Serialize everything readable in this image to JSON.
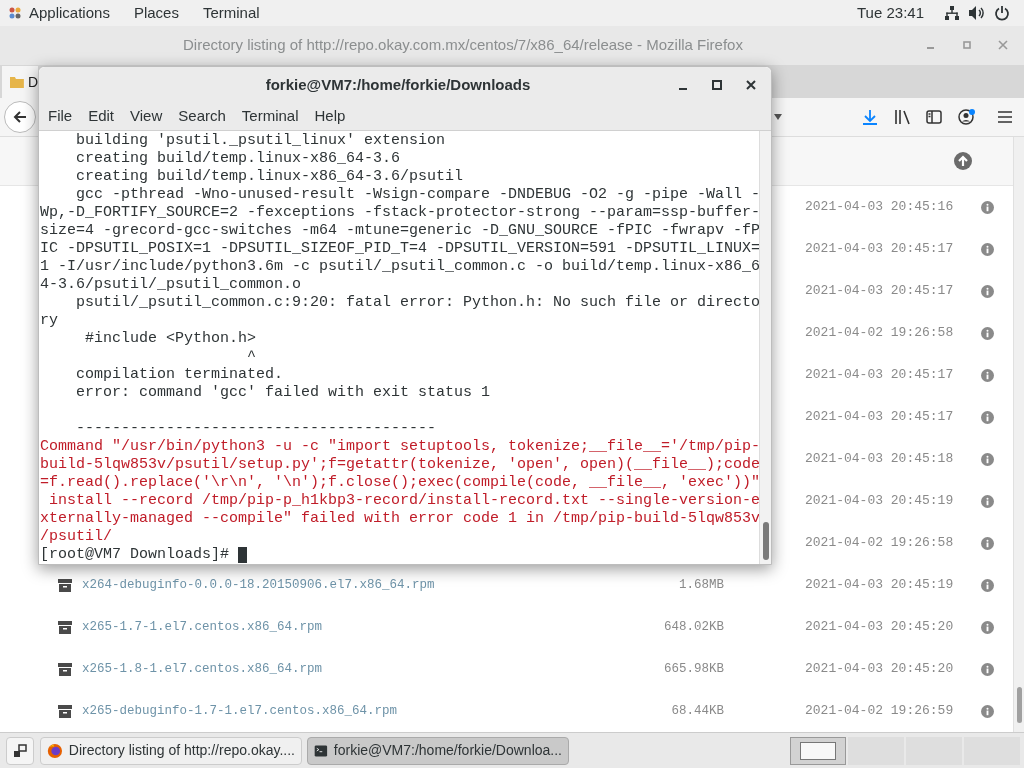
{
  "top_bar": {
    "menus": [
      "Applications",
      "Places",
      "Terminal"
    ],
    "clock": "Tue 23:41"
  },
  "browser": {
    "title": "Directory listing of http://repo.okay.com.mx/centos/7/x86_64/release - Mozilla Firefox",
    "tab": {
      "label": "D"
    },
    "listing": [
      {
        "date": "2021-04-03 20:45:16"
      },
      {
        "date": "2021-04-03 20:45:17"
      },
      {
        "date": "2021-04-03 20:45:17"
      },
      {
        "date": "2021-04-02 19:26:58"
      },
      {
        "date": "2021-04-03 20:45:17"
      },
      {
        "date": "2021-04-03 20:45:17"
      },
      {
        "date": "2021-04-03 20:45:18"
      },
      {
        "date": "2021-04-03 20:45:19"
      },
      {
        "date": "2021-04-02 19:26:58"
      },
      {
        "name": "x264-debuginfo-0.0.0-18.20150906.el7.x86_64.rpm",
        "size": "1.68MB",
        "date": "2021-04-03 20:45:19"
      },
      {
        "name": "x265-1.7-1.el7.centos.x86_64.rpm",
        "size": "648.02KB",
        "date": "2021-04-03 20:45:20"
      },
      {
        "name": "x265-1.8-1.el7.centos.x86_64.rpm",
        "size": "665.98KB",
        "date": "2021-04-03 20:45:20"
      },
      {
        "name": "x265-debuginfo-1.7-1.el7.centos.x86_64.rpm",
        "size": "68.44KB",
        "date": "2021-04-02 19:26:59"
      }
    ]
  },
  "terminal": {
    "title": "forkie@VM7:/home/forkie/Downloads",
    "menus": [
      "File",
      "Edit",
      "View",
      "Search",
      "Terminal",
      "Help"
    ],
    "lines": [
      {
        "kind": "output",
        "text": "    building 'psutil._psutil_linux' extension"
      },
      {
        "kind": "output",
        "text": "    creating build/temp.linux-x86_64-3.6"
      },
      {
        "kind": "output",
        "text": "    creating build/temp.linux-x86_64-3.6/psutil"
      },
      {
        "kind": "output",
        "text": "    gcc -pthread -Wno-unused-result -Wsign-compare -DNDEBUG -O2 -g -pipe -Wall -"
      },
      {
        "kind": "output",
        "text": "Wp,-D_FORTIFY_SOURCE=2 -fexceptions -fstack-protector-strong --param=ssp-buffer-"
      },
      {
        "kind": "output",
        "text": "size=4 -grecord-gcc-switches -m64 -mtune=generic -D_GNU_SOURCE -fPIC -fwrapv -fP"
      },
      {
        "kind": "output",
        "text": "IC -DPSUTIL_POSIX=1 -DPSUTIL_SIZEOF_PID_T=4 -DPSUTIL_VERSION=591 -DPSUTIL_LINUX="
      },
      {
        "kind": "output",
        "text": "1 -I/usr/include/python3.6m -c psutil/_psutil_common.c -o build/temp.linux-x86_6"
      },
      {
        "kind": "output",
        "text": "4-3.6/psutil/_psutil_common.o"
      },
      {
        "kind": "output",
        "text": "    psutil/_psutil_common.c:9:20: fatal error: Python.h: No such file or directo"
      },
      {
        "kind": "output",
        "text": "ry"
      },
      {
        "kind": "output",
        "text": "     #include <Python.h>"
      },
      {
        "kind": "output",
        "text": "                       ^"
      },
      {
        "kind": "output",
        "text": "    compilation terminated."
      },
      {
        "kind": "output",
        "text": "    error: command 'gcc' failed with exit status 1"
      },
      {
        "kind": "blank"
      },
      {
        "kind": "output",
        "text": "    ----------------------------------------"
      },
      {
        "kind": "error",
        "text": "Command \"/usr/bin/python3 -u -c \"import setuptools, tokenize;__file__='/tmp/pip-"
      },
      {
        "kind": "error",
        "text": "build-5lqw853v/psutil/setup.py';f=getattr(tokenize, 'open', open)(__file__);code"
      },
      {
        "kind": "error",
        "text": "=f.read().replace('\\r\\n', '\\n');f.close();exec(compile(code, __file__, 'exec'))\""
      },
      {
        "kind": "error",
        "text": " install --record /tmp/pip-p_h1kbp3-record/install-record.txt --single-version-e"
      },
      {
        "kind": "error",
        "text": "xternally-managed --compile\" failed with error code 1 in /tmp/pip-build-5lqw853v"
      },
      {
        "kind": "error",
        "text": "/psutil/"
      }
    ],
    "prompt": "[root@VM7 Downloads]#"
  },
  "taskbar": {
    "windows": [
      {
        "kind": "browser",
        "label": "Directory listing of http://repo.okay....",
        "selected": false
      },
      {
        "kind": "terminal",
        "label": "forkie@VM7:/home/forkie/Downloa...",
        "selected": true
      }
    ],
    "workspaces": [
      {
        "selected": true
      },
      {
        "selected": false
      },
      {
        "selected": false
      },
      {
        "selected": false
      }
    ]
  }
}
